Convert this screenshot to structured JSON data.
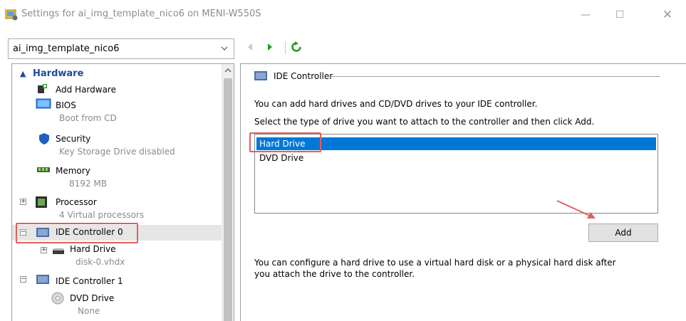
{
  "window": {
    "title": "Settings for ai_img_template_nico6 on MENI-W550S",
    "minimize_glyph": "—",
    "maximize_glyph": "☐",
    "close_glyph": "✕"
  },
  "vm_selector": {
    "value": "ai_img_template_nico6"
  },
  "tree": {
    "section": "Hardware",
    "items": [
      {
        "name": "Add Hardware",
        "icon": "add-hardware-icon"
      },
      {
        "name": "BIOS",
        "sub": "Boot from CD",
        "icon": "bios-icon"
      },
      {
        "name": "Security",
        "sub": "Key Storage Drive disabled",
        "icon": "shield-icon"
      },
      {
        "name": "Memory",
        "sub": "8192 MB",
        "icon": "memory-icon"
      },
      {
        "name": "Processor",
        "sub": "4 Virtual processors",
        "icon": "processor-icon"
      },
      {
        "name": "IDE Controller 0",
        "icon": "ide-controller-icon"
      },
      {
        "name": "Hard Drive",
        "sub": "disk-0.vhdx",
        "icon": "hard-drive-icon"
      },
      {
        "name": "IDE Controller 1",
        "icon": "ide-controller-icon"
      },
      {
        "name": "DVD Drive",
        "sub": "None",
        "icon": "dvd-icon"
      }
    ]
  },
  "panel": {
    "group_title": "IDE Controller",
    "intro": "You can add hard drives and CD/DVD drives to your IDE controller.",
    "instruction": "Select the type of drive you want to attach to the controller and then click Add.",
    "drive_types": [
      "Hard Drive",
      "DVD Drive"
    ],
    "selected_drive": "Hard Drive",
    "add_label": "Add",
    "note_line1": "You can configure a hard drive to use a virtual hard disk or a physical hard disk after",
    "note_line2": "you attach the drive to the controller."
  },
  "colors": {
    "selection": "#0078d7",
    "annotation": "#e0605a",
    "section_header": "#1e4a9e"
  }
}
